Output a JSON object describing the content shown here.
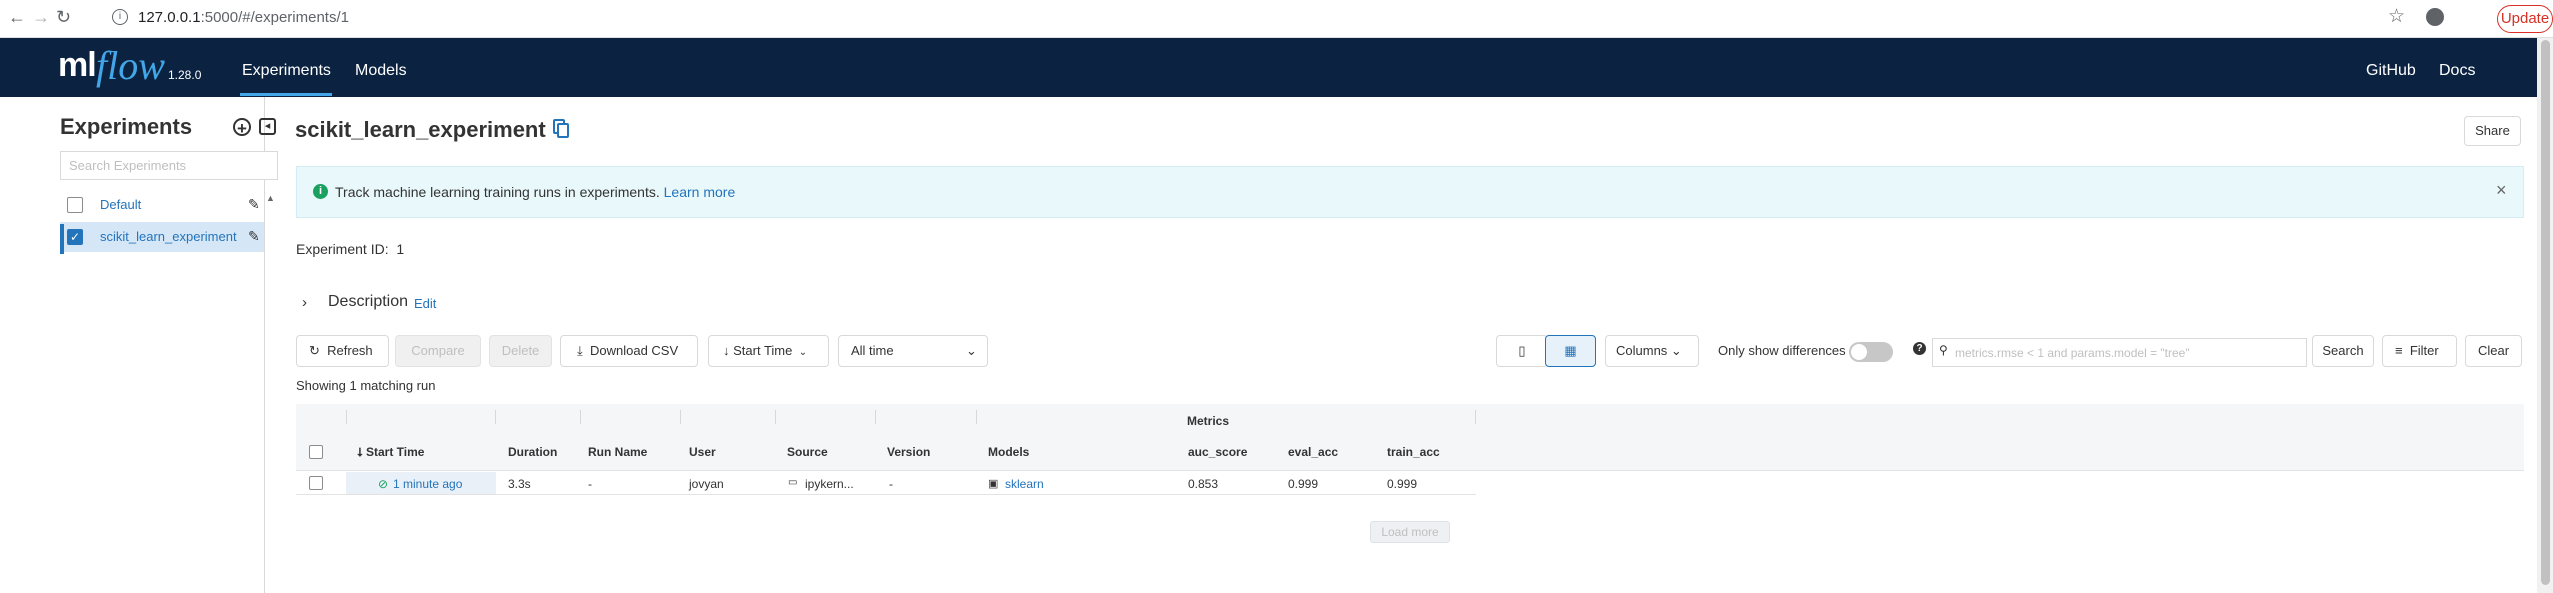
{
  "browser": {
    "url_host": "127.0.0.1",
    "url_rest": ":5000/#/experiments/1",
    "update_label": "Update"
  },
  "header": {
    "logo_ml": "ml",
    "logo_flow": "flow",
    "version": "1.28.0",
    "nav": [
      "Experiments",
      "Models"
    ],
    "right_links": [
      "GitHub",
      "Docs"
    ]
  },
  "sidebar": {
    "title": "Experiments",
    "search_placeholder": "Search Experiments",
    "items": [
      {
        "label": "Default",
        "checked": false
      },
      {
        "label": "scikit_learn_experiment",
        "checked": true
      }
    ]
  },
  "main": {
    "title": "scikit_learn_experiment",
    "share_label": "Share",
    "banner_text": "Track machine learning training runs in experiments.",
    "banner_link": "Learn more",
    "experiment_id_label": "Experiment ID:",
    "experiment_id": "1",
    "description_label": "Description",
    "description_edit": "Edit"
  },
  "toolbar": {
    "refresh": "Refresh",
    "compare": "Compare",
    "delete": "Delete",
    "download_csv": "Download CSV",
    "sort": "Start Time",
    "time_range": "All time",
    "columns": "Columns",
    "only_diff": "Only show differences",
    "search_placeholder": "metrics.rmse < 1 and params.model = \"tree\"",
    "search": "Search",
    "filter": "Filter",
    "clear": "Clear"
  },
  "runs": {
    "count_text": "Showing 1 matching run",
    "group_header": "Metrics",
    "columns": [
      "Start Time",
      "Duration",
      "Run Name",
      "User",
      "Source",
      "Version",
      "Models",
      "auc_score",
      "eval_acc",
      "train_acc"
    ],
    "rows": [
      {
        "start_time": "1 minute ago",
        "duration": "3.3s",
        "run_name": "-",
        "user": "jovyan",
        "source": "ipykern...",
        "version": "-",
        "models": "sklearn",
        "auc_score": "0.853",
        "eval_acc": "0.999",
        "train_acc": "0.999"
      }
    ],
    "load_more": "Load more"
  }
}
